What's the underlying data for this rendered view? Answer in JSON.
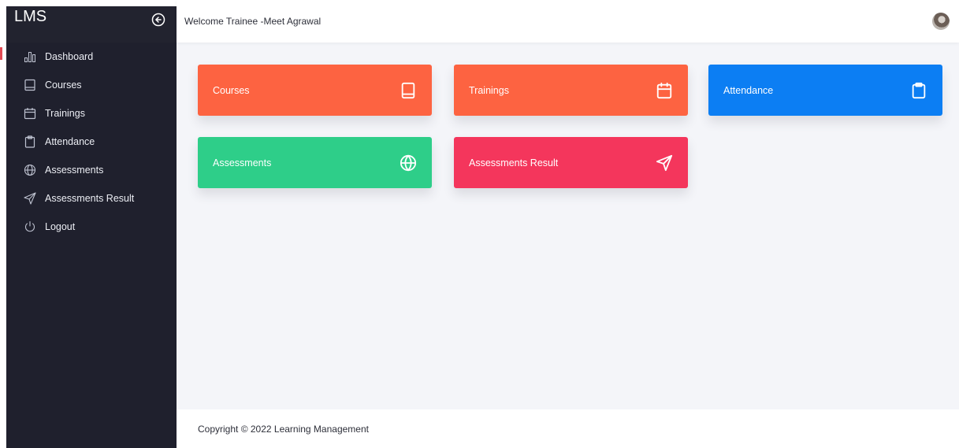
{
  "sidebar": {
    "brand": "LMS",
    "toggle_icon": "arrow-left-circle-icon",
    "active_indicator_color": "#e34b54",
    "items": [
      {
        "label": "Dashboard",
        "icon": "bar-chart-icon",
        "active": true
      },
      {
        "label": "Courses",
        "icon": "book-icon"
      },
      {
        "label": "Trainings",
        "icon": "calendar-icon"
      },
      {
        "label": "Attendance",
        "icon": "clipboard-icon"
      },
      {
        "label": "Assessments",
        "icon": "globe-icon"
      },
      {
        "label": "Assessments Result",
        "icon": "send-icon"
      },
      {
        "label": "Logout",
        "icon": "power-icon"
      }
    ]
  },
  "header": {
    "welcome": "Welcome Trainee -Meet Agrawal"
  },
  "cards": [
    {
      "label": "Courses",
      "icon": "book-icon",
      "color": "#fd6341"
    },
    {
      "label": "Trainings",
      "icon": "calendar-icon",
      "color": "#fd6341"
    },
    {
      "label": "Attendance",
      "icon": "clipboard-icon",
      "color": "#0c7ef3"
    },
    {
      "label": "Assessments",
      "icon": "globe-icon",
      "color": "#2ece89"
    },
    {
      "label": "Assessments Result",
      "icon": "send-icon",
      "color": "#f4365c"
    }
  ],
  "footer": {
    "copyright": "Copyright © 2022 Learning Management"
  }
}
